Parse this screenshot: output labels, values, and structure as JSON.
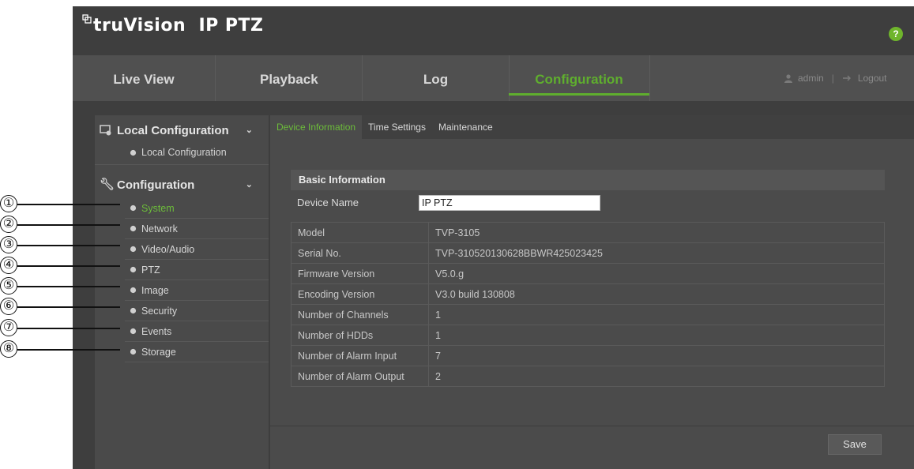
{
  "app": {
    "logo_text": "truVision  IP PTZ",
    "help_label": "?"
  },
  "nav": {
    "tabs": [
      {
        "label": "Live View"
      },
      {
        "label": "Playback"
      },
      {
        "label": "Log"
      },
      {
        "label": "Configuration",
        "active": true
      }
    ],
    "user": "admin",
    "logout": "Logout"
  },
  "sidebar": {
    "local_header": "Local Configuration",
    "local_items": [
      {
        "label": "Local Configuration"
      }
    ],
    "config_header": "Configuration",
    "config_items": [
      {
        "label": "System",
        "active": true
      },
      {
        "label": "Network"
      },
      {
        "label": "Video/Audio"
      },
      {
        "label": "PTZ"
      },
      {
        "label": "Image"
      },
      {
        "label": "Security"
      },
      {
        "label": "Events"
      },
      {
        "label": "Storage"
      }
    ]
  },
  "subtabs": [
    {
      "label": "Device Information",
      "active": true
    },
    {
      "label": "Time Settings"
    },
    {
      "label": "Maintenance"
    }
  ],
  "device_info": {
    "section_title": "Basic Information",
    "device_name_label": "Device Name",
    "device_name_value": "IP PTZ",
    "rows": [
      {
        "label": "Model",
        "value": "TVP-3105"
      },
      {
        "label": "Serial No.",
        "value": "TVP-310520130628BBWR425023425"
      },
      {
        "label": "Firmware Version",
        "value": "V5.0.g"
      },
      {
        "label": "Encoding Version",
        "value": "V3.0 build 130808"
      },
      {
        "label": "Number of Channels",
        "value": "1"
      },
      {
        "label": "Number of HDDs",
        "value": "1"
      },
      {
        "label": "Number of Alarm Input",
        "value": "7"
      },
      {
        "label": "Number of Alarm Output",
        "value": "2"
      }
    ]
  },
  "save_label": "Save",
  "callouts": [
    "①",
    "②",
    "③",
    "④",
    "⑤",
    "⑥",
    "⑦",
    "⑧"
  ],
  "colors": {
    "accent": "#6cbc3a",
    "help_badge": "#6fb52c"
  }
}
